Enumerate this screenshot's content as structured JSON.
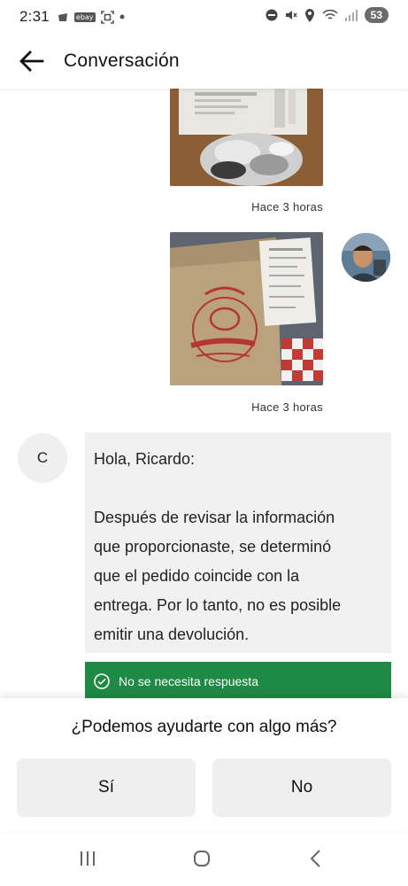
{
  "status_bar": {
    "time": "2:31",
    "battery": "53",
    "left_icons": [
      "bag-icon",
      "ebay-icon",
      "screenshot-icon",
      "dot-icon"
    ],
    "right_icons": [
      "dnd-icon",
      "mute-icon",
      "location-icon",
      "wifi-icon",
      "signal-icon"
    ],
    "ebay_label": "ebay"
  },
  "header": {
    "title": "Conversación",
    "back_icon": "arrow-left-icon"
  },
  "messages": [
    {
      "type": "image",
      "sender": "user",
      "content": "receipt-foil-wrap-photo",
      "timestamp": "Hace 3 horas"
    },
    {
      "type": "image",
      "sender": "user",
      "content": "gilligan-burger-bag-photo",
      "timestamp": "Hace 3 horas"
    },
    {
      "type": "text",
      "sender": "support",
      "avatar_letter": "C",
      "greeting": "Hola, Ricardo:",
      "body": "Después de revisar la información que proporcionaste, se determinó que el pedido coincide con la entrega. Por lo tanto, no es posible emitir una devolución.",
      "body_lines": [
        "Después de revisar la información",
        "que proporcionaste, se determinó",
        "que el pedido coincide con la",
        "entrega. Por lo tanto, no es posible",
        "emitir una devolución."
      ]
    }
  ],
  "status_banner": {
    "text": "No se necesita respuesta",
    "icon": "check-circle-icon",
    "color": "#1e8a46"
  },
  "bottom_sheet": {
    "question": "¿Podemos ayudarte con algo más?",
    "yes_label": "Sí",
    "no_label": "No"
  },
  "nav_bar": {
    "icons": [
      "recents-icon",
      "home-icon",
      "back-icon"
    ]
  }
}
